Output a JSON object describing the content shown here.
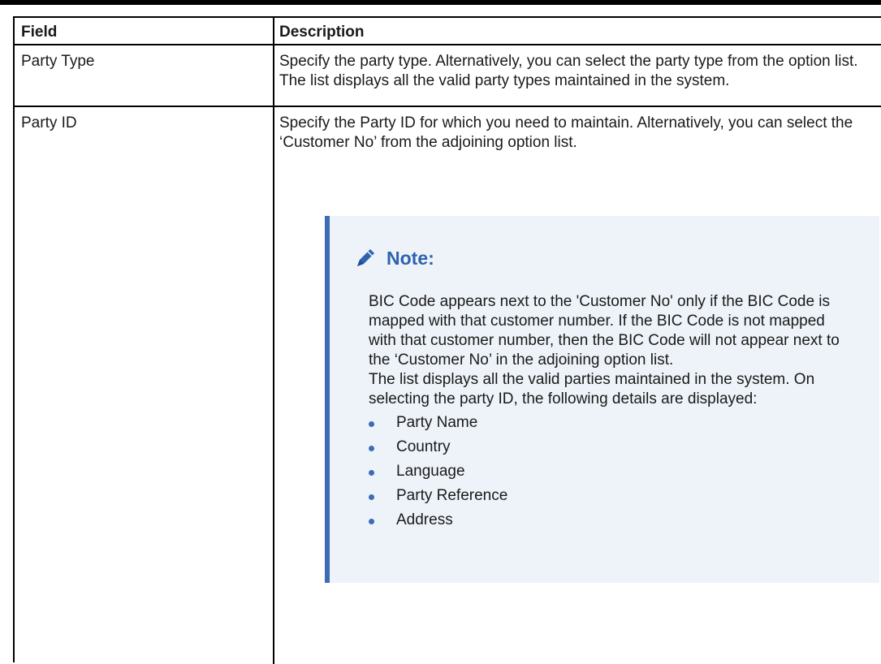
{
  "table": {
    "headers": {
      "field": "Field",
      "description": "Description"
    },
    "rows": [
      {
        "field": "Party Type",
        "description": "Specify the party type. Alternatively, you can select the party type from the option list. The list displays all the valid party types maintained in the system."
      },
      {
        "field": "Party ID",
        "description": "Specify the Party ID for which you need to maintain. Alternatively, you can select the ‘Customer No’ from the adjoining option list.",
        "note": {
          "title": "Note:",
          "icon": "pencil-icon",
          "paragraphs": [
            "BIC Code appears next to the 'Customer No' only if the BIC Code is mapped with that customer number. If the BIC Code is not mapped with that customer number, then the BIC Code will not appear next to the ‘Customer No’ in the adjoining option list.",
            "The list displays all the valid parties maintained in the system. On selecting the party ID, the following details are displayed:"
          ],
          "bullets": [
            "Party Name",
            "Country",
            "Language",
            "Party Reference",
            "Address"
          ]
        }
      }
    ]
  },
  "colors": {
    "note_background": "#eef3f9",
    "note_accent": "#3c6cb3",
    "note_title": "#2f63ad"
  }
}
